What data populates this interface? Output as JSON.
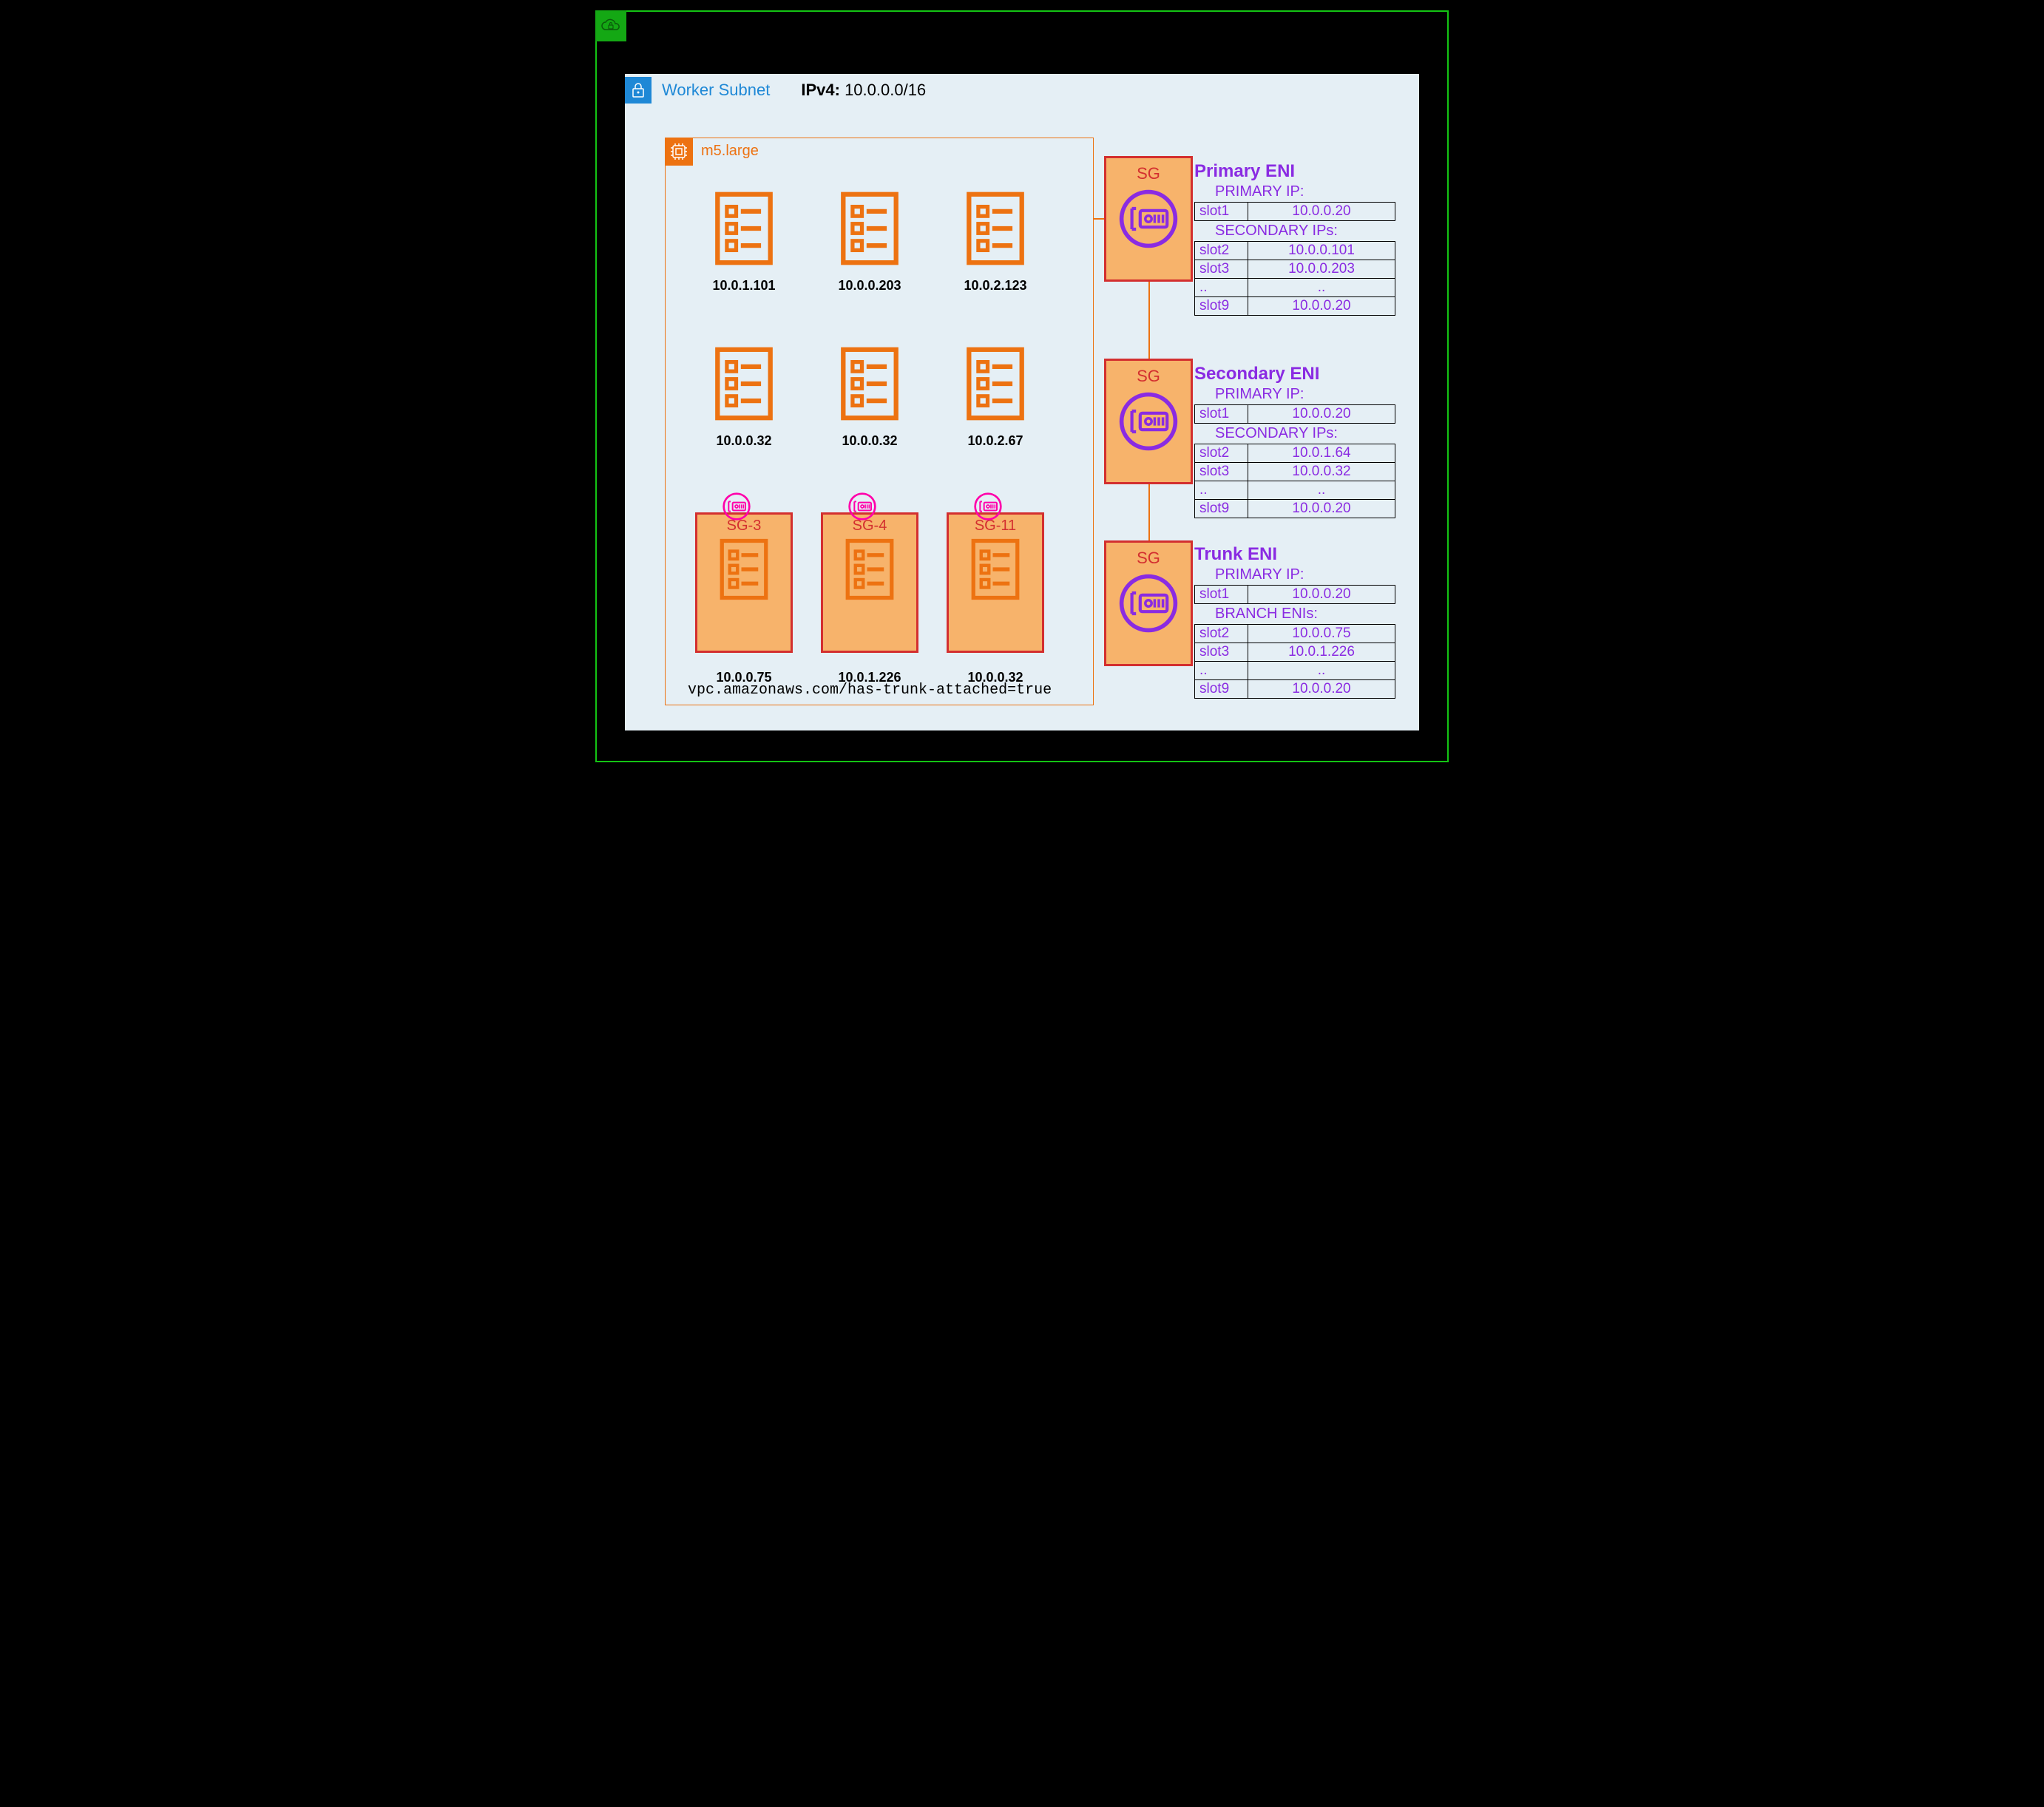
{
  "subnet": {
    "title": "Worker Subnet",
    "ipv4_label": "IPv4:",
    "ipv4_value": "10.0.0.0/16"
  },
  "instance": {
    "type": "m5.large",
    "annotation": "vpc.amazonaws.com/has-trunk-attached=true"
  },
  "pods": {
    "row1": [
      "10.0.1.101",
      "10.0.0.203",
      "10.0.2.123"
    ],
    "row2": [
      "10.0.0.32",
      "10.0.0.32",
      "10.0.2.67"
    ],
    "row3": [
      {
        "sg": "SG-3",
        "ip": "10.0.0.75"
      },
      {
        "sg": "SG-4",
        "ip": "10.0.1.226"
      },
      {
        "sg": "SG-11",
        "ip": "10.0.0.32"
      }
    ]
  },
  "sg_label": "SG",
  "enis": [
    {
      "title": "Primary ENI",
      "primary_label": "PRIMARY IP:",
      "primary": {
        "slot": "slot1",
        "ip": "10.0.0.20"
      },
      "secondary_label": "SECONDARY IPs:",
      "rows": [
        {
          "slot": "slot2",
          "ip": "10.0.0.101"
        },
        {
          "slot": "slot3",
          "ip": "10.0.0.203"
        },
        {
          "slot": "..",
          "ip": ".."
        },
        {
          "slot": "slot9",
          "ip": "10.0.0.20"
        }
      ]
    },
    {
      "title": "Secondary ENI",
      "primary_label": "PRIMARY IP:",
      "primary": {
        "slot": "slot1",
        "ip": "10.0.0.20"
      },
      "secondary_label": "SECONDARY IPs:",
      "rows": [
        {
          "slot": "slot2",
          "ip": "10.0.1.64"
        },
        {
          "slot": "slot3",
          "ip": "10.0.0.32"
        },
        {
          "slot": "..",
          "ip": ".."
        },
        {
          "slot": "slot9",
          "ip": "10.0.0.20"
        }
      ]
    },
    {
      "title": "Trunk ENI",
      "primary_label": "PRIMARY IP:",
      "primary": {
        "slot": "slot1",
        "ip": "10.0.0.20"
      },
      "secondary_label": "BRANCH ENIs:",
      "rows": [
        {
          "slot": "slot2",
          "ip": "10.0.0.75"
        },
        {
          "slot": "slot3",
          "ip": "10.0.1.226"
        },
        {
          "slot": "..",
          "ip": ".."
        },
        {
          "slot": "slot9",
          "ip": "10.0.0.20"
        }
      ]
    }
  ]
}
